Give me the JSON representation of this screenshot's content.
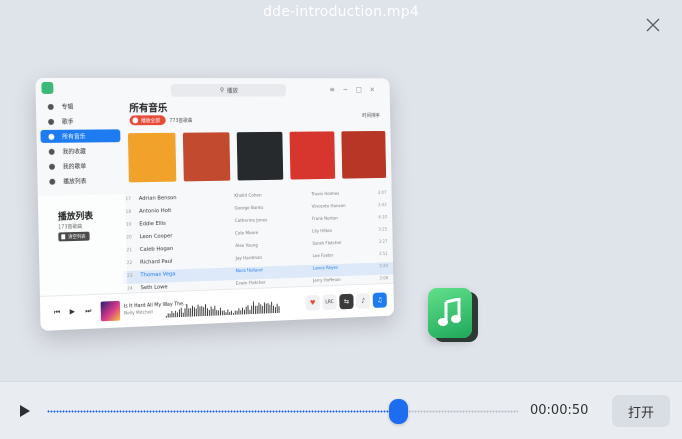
{
  "window": {
    "title": "dde-introduction.mp4"
  },
  "video": {
    "app": {
      "sidebar": [
        {
          "label": "专辑",
          "active": false
        },
        {
          "label": "歌手",
          "active": false
        },
        {
          "label": "所有音乐",
          "active": true
        },
        {
          "label": "我的收藏",
          "active": false
        },
        {
          "label": "我的歌单",
          "active": false
        },
        {
          "label": "播放列表",
          "active": false
        }
      ],
      "search_placeholder": "播放",
      "main_title": "所有音乐",
      "play_all_label": "播放全部",
      "track_count": "773首歌曲",
      "sort_label": "时间排序",
      "album_colors": [
        "#f0a22a",
        "#c24a2e",
        "#262a2c",
        "#d7362e",
        "#b83626"
      ],
      "playlist": {
        "title": "播放列表",
        "count": "173首歌曲",
        "clear_label": "清空列表"
      },
      "rows": [
        {
          "num": "17",
          "name": "Adrian Benson",
          "artist": "Khalid Cohen",
          "album": "Travis Holmes",
          "dur": "3:07",
          "active": false
        },
        {
          "num": "18",
          "name": "Antonio Holt",
          "artist": "George Banks",
          "album": "Vincente Hanson",
          "dur": "3:42",
          "active": false
        },
        {
          "num": "19",
          "name": "Eddie Ellis",
          "artist": "Catherine Jones",
          "album": "Frank Norton",
          "dur": "4:10",
          "active": false
        },
        {
          "num": "20",
          "name": "Leon Cooper",
          "artist": "Cole Moore",
          "album": "Lily Hilton",
          "dur": "3:25",
          "active": false
        },
        {
          "num": "21",
          "name": "Caleb Hogan",
          "artist": "Alex Young",
          "album": "Sarah Fletcher",
          "dur": "3:27",
          "active": false
        },
        {
          "num": "22",
          "name": "Richard Paul",
          "artist": "Jay Hardman",
          "album": "Lee Foster",
          "dur": "3:51",
          "active": false
        },
        {
          "num": "23",
          "name": "Thomas Vega",
          "artist": "Nora Holland",
          "album": "Lance Reyes",
          "dur": "3:29",
          "active": true
        },
        {
          "num": "24",
          "name": "Seth Lowe",
          "artist": "Erwin Fletcher",
          "album": "Jerry Hoffman",
          "dur": "3:08",
          "active": false
        }
      ],
      "player": {
        "song": "Is It Hard All My Way The...",
        "artist": "Nelly Mitchell"
      }
    }
  },
  "controls": {
    "time": "00:00:50",
    "open_label": "打开",
    "progress": 0.745,
    "accent": "#1e6cf0"
  }
}
